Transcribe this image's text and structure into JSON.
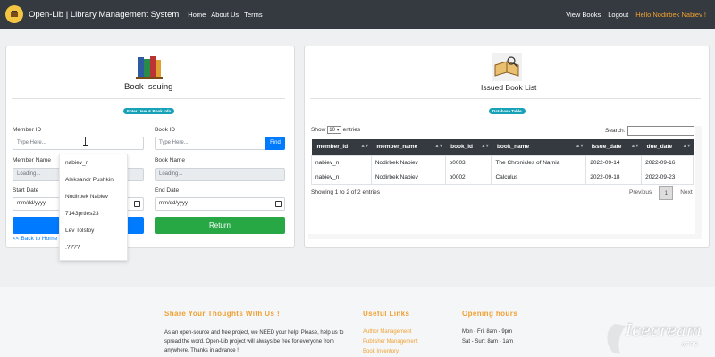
{
  "navbar": {
    "brand": "Open-Lib | Library Management System",
    "links": [
      "Home",
      "About Us",
      "Terms"
    ],
    "right_links": [
      "View Books",
      "Logout"
    ],
    "user": "Hello Nodirbek Nabiev !"
  },
  "issuing": {
    "title": "Book Issuing",
    "badge": "Enter User & Book Info",
    "member_id_label": "Member ID",
    "member_id_placeholder": "Type Here...",
    "book_id_label": "Book ID",
    "book_id_placeholder": "Type Here...",
    "find_label": "Find",
    "member_name_label": "Member Name",
    "member_name_value": "Loading...",
    "book_name_label": "Book Name",
    "book_name_value": "Loading...",
    "start_date_label": "Start Date",
    "end_date_label": "End Date",
    "date_placeholder": "mm/dd/yyyy",
    "return_label": "Return",
    "back_link": "<< Back to Home"
  },
  "dropdown": {
    "items": [
      "nabiev_n",
      "Aleksandr Pushkin",
      "Nodirbek Nabiev",
      "7143prties23",
      "Lev Tolstoy",
      ".????"
    ]
  },
  "issued": {
    "title": "Issued Book List",
    "badge": "Database Table",
    "show": "Show",
    "show_value": "10",
    "entries": "entries",
    "search_label": "Search:",
    "columns": [
      "member_id",
      "member_name",
      "book_id",
      "book_name",
      "issue_date",
      "due_date"
    ],
    "rows": [
      [
        "nabiev_n",
        "Nodirbek Nabiev",
        "b0003",
        "The Chronicles of Narnia",
        "2022-09-14",
        "2022-09-16"
      ],
      [
        "nabiev_n",
        "Nodirbek Nabiev",
        "b0002",
        "Calculus",
        "2022-09-18",
        "2022-09-23"
      ]
    ],
    "info": "Showing 1 to 2 of 2 entries",
    "prev": "Previous",
    "page": "1",
    "next": "Next"
  },
  "footer": {
    "share_title": "Share Your Thoughts With Us !",
    "share_text": "As an open-source and free project, we NEED your help! Please, help us to spread the word. Open-Lib project will always be free for everyone from anywhere. Thanks in advance !",
    "links_title": "Useful Links",
    "links": [
      "Author Management",
      "Publisher Management",
      "Book Inventory"
    ],
    "hours_title": "Opening hours",
    "hours": [
      "Mon - Fri: 8am - 9pm",
      "Sat - Sun: 8am - 1am"
    ],
    "watermark": "Icecream",
    "watermark_sub": "APPS"
  },
  "colors": {
    "navbar": "#343a40",
    "primary": "#007bff",
    "success": "#28a745",
    "info": "#17a2b8",
    "accent": "#f0a030"
  }
}
